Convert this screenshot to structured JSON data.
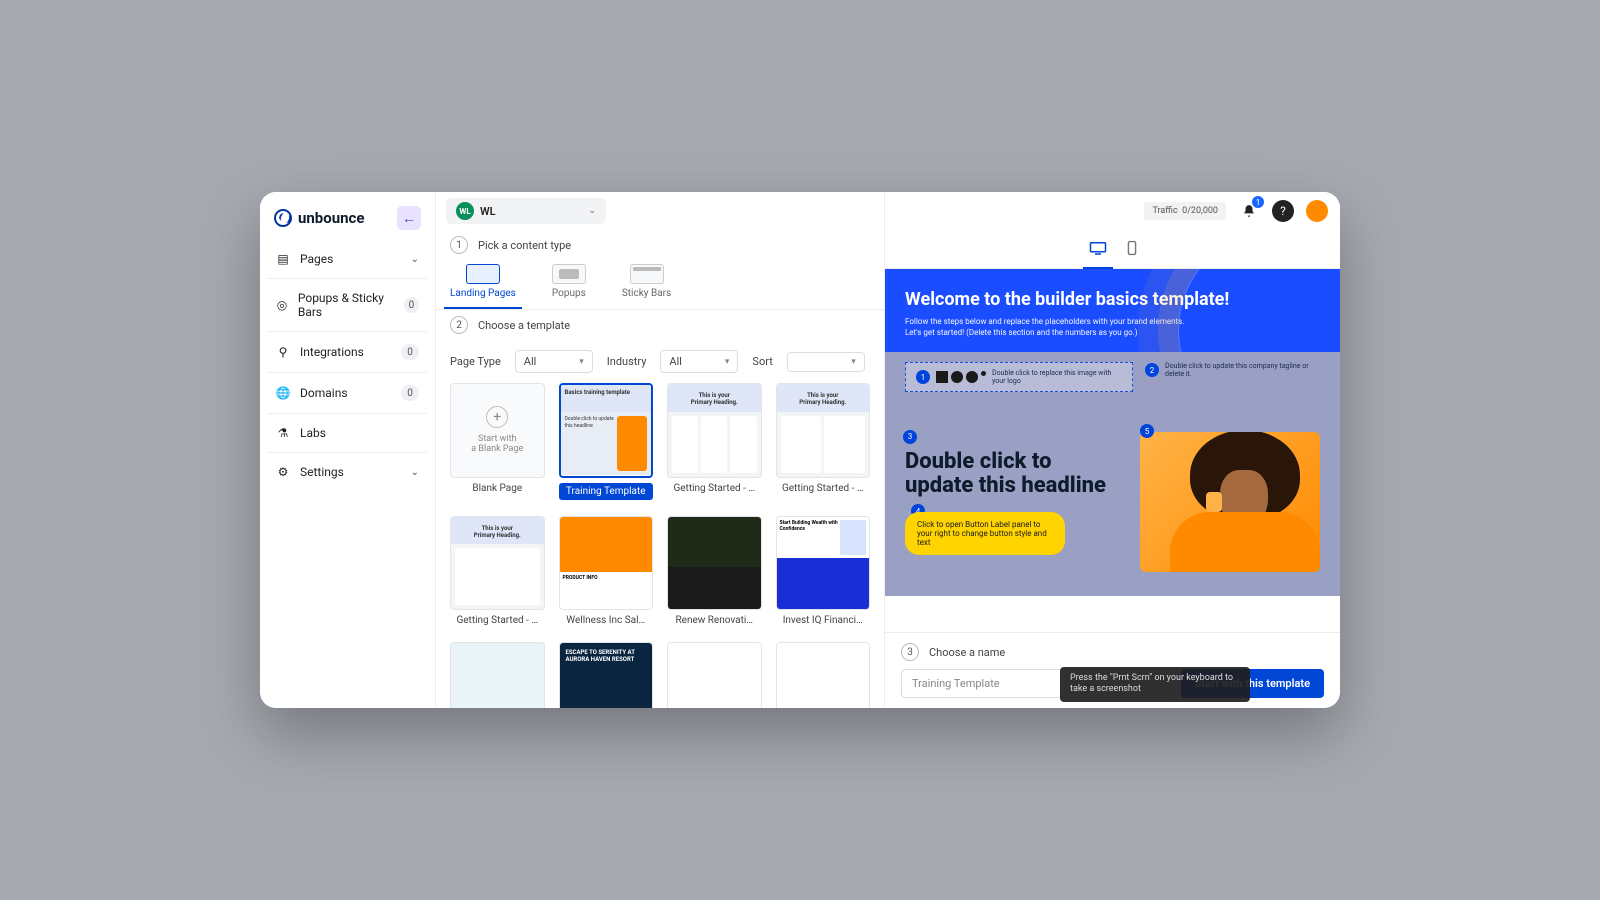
{
  "brand": "unbounce",
  "workspace": {
    "initials": "WL",
    "name": "WL"
  },
  "traffic": {
    "label": "Traffic",
    "value": "0/20,000"
  },
  "notifications": "1",
  "sidebar": {
    "items": [
      {
        "label": "Pages",
        "chevron": true
      },
      {
        "label": "Popups & Sticky Bars",
        "badge": "0"
      },
      {
        "label": "Integrations",
        "badge": "0"
      },
      {
        "label": "Domains",
        "badge": "0"
      },
      {
        "label": "Labs"
      },
      {
        "label": "Settings",
        "chevron": true
      }
    ]
  },
  "steps": {
    "s1": {
      "num": "1",
      "label": "Pick a content type"
    },
    "s2": {
      "num": "2",
      "label": "Choose a template"
    },
    "s3": {
      "num": "3",
      "label": "Choose a name"
    }
  },
  "content_types": {
    "landing": "Landing Pages",
    "popups": "Popups",
    "sticky": "Sticky Bars"
  },
  "filters": {
    "page_type_label": "Page Type",
    "page_type_value": "All",
    "industry_label": "Industry",
    "industry_value": "All",
    "sort_label": "Sort",
    "sort_value": ""
  },
  "templates": [
    {
      "name": "Blank Page",
      "blank_text": "Start with\na Blank Page"
    },
    {
      "name": "Training Template"
    },
    {
      "name": "Getting Started - …"
    },
    {
      "name": "Getting Started - …"
    },
    {
      "name": "Getting Started - …"
    },
    {
      "name": "Wellness Inc Sal…"
    },
    {
      "name": "Renew Renovati…"
    },
    {
      "name": "Invest IQ Financi…"
    }
  ],
  "preview": {
    "hero_title": "Welcome to the builder basics template!",
    "hero_sub1": "Follow the steps below and replace the placeholders with your brand elements.",
    "hero_sub2": "Let's get started! (Delete this section and the numbers as you go.)",
    "badges": {
      "b1": "1",
      "b2": "2",
      "b3": "3",
      "b4": "4",
      "b5": "5"
    },
    "logo_hint": "Double click to replace this image with your logo",
    "tagline_hint": "Double click to update this company tagline or delete it.",
    "headline": "Double click to update this headline",
    "button_hint": "Click to open Button Label panel to your right to change button style and text"
  },
  "name_field": {
    "value": "Training Template"
  },
  "start_button": "Start with this template",
  "tooltip": "Press the \"Prnt Scrn\" on your keyboard to take a screenshot"
}
